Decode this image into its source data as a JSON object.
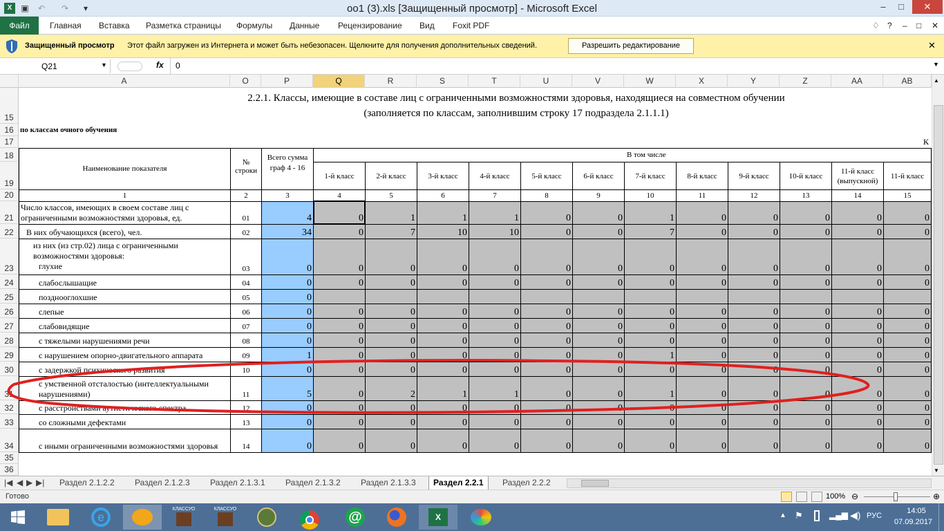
{
  "window": {
    "title": "oo1 (3).xls  [Защищенный просмотр]  -  Microsoft Excel",
    "controls": [
      "–",
      "□",
      "✕"
    ]
  },
  "ribbon_tabs": [
    "Файл",
    "Главная",
    "Вставка",
    "Разметка страницы",
    "Формулы",
    "Данные",
    "Рецензирование",
    "Вид",
    "Foxit PDF"
  ],
  "protected_view": {
    "label": "Защищенный просмотр",
    "message": "Этот файл загружен из Интернета и может быть небезопасен. Щелкните для получения дополнительных сведений.",
    "button": "Разрешить редактирование"
  },
  "formula_bar": {
    "name_box": "Q21",
    "fx": "fx",
    "value": "0"
  },
  "columns": [
    "A",
    "O",
    "P",
    "Q",
    "R",
    "S",
    "T",
    "U",
    "V",
    "W",
    "X",
    "Y",
    "Z",
    "AA",
    "AB"
  ],
  "rows": [
    "15",
    "16",
    "17",
    "18",
    "19",
    "20",
    "21",
    "22",
    "23",
    "24",
    "25",
    "26",
    "27",
    "28",
    "29",
    "30",
    "31",
    "32",
    "33",
    "34",
    "35",
    "36"
  ],
  "sheet": {
    "title_line1": "2.2.1. Классы, имеющие в составе лиц с ограниченными возможностями здоровья, находящиеся на совместном обучении",
    "title_line2": "(заполняется по классам, заполнившим строку 17 подраздела 2.1.1.1)",
    "subtitle": "по классам очного обучения",
    "corner_text": "К",
    "header_name": "Наименование показателя",
    "header_rownum": "№ строки",
    "header_total": "Всего сумма граф 4 - 16",
    "header_group": "В том числе",
    "class_headers": [
      "1-й класс",
      "2-й класс",
      "3-й класс",
      "4-й класс",
      "5-й класс",
      "6-й класс",
      "7-й класс",
      "8-й класс",
      "9-й класс",
      "10-й класс",
      "11-й класс (выпускной)",
      "11-й класс"
    ],
    "col_numbers": [
      "1",
      "2",
      "3",
      "4",
      "5",
      "6",
      "7",
      "8",
      "9",
      "10",
      "11",
      "12",
      "13",
      "14",
      "15"
    ],
    "data_rows": [
      {
        "label": "Число классов, имеющих в своем составе лиц с ограниченными возможностями здоровья, ед.",
        "code": "01",
        "total": "4",
        "vals": [
          "0",
          "1",
          "1",
          "1",
          "0",
          "0",
          "1",
          "0",
          "0",
          "0",
          "0",
          "0"
        ]
      },
      {
        "label": "В них обучающихся (всего), чел.",
        "code": "02",
        "total": "34",
        "vals": [
          "0",
          "7",
          "10",
          "10",
          "0",
          "0",
          "7",
          "0",
          "0",
          "0",
          "0",
          "0"
        ]
      },
      {
        "label": "из них (из стр.02) лица с ограниченными возможностями здоровья:",
        "sub": "глухие",
        "code": "03",
        "total": "0",
        "vals": [
          "0",
          "0",
          "0",
          "0",
          "0",
          "0",
          "0",
          "0",
          "0",
          "0",
          "0",
          "0"
        ]
      },
      {
        "label": "слабослышащие",
        "code": "04",
        "total": "0",
        "vals": [
          "0",
          "0",
          "0",
          "0",
          "0",
          "0",
          "0",
          "0",
          "0",
          "0",
          "0",
          "0"
        ]
      },
      {
        "label": "позднооглохшие",
        "code": "05",
        "total": "0",
        "vals": [
          "",
          "",
          "",
          "",
          "",
          "",
          "",
          "",
          "",
          "",
          "",
          ""
        ]
      },
      {
        "label": "слепые",
        "code": "06",
        "total": "0",
        "vals": [
          "0",
          "0",
          "0",
          "0",
          "0",
          "0",
          "0",
          "0",
          "0",
          "0",
          "0",
          "0"
        ]
      },
      {
        "label": "слабовидящие",
        "code": "07",
        "total": "0",
        "vals": [
          "0",
          "0",
          "0",
          "0",
          "0",
          "0",
          "0",
          "0",
          "0",
          "0",
          "0",
          "0"
        ]
      },
      {
        "label": "с тяжелыми нарушениями речи",
        "code": "08",
        "total": "0",
        "vals": [
          "0",
          "0",
          "0",
          "0",
          "0",
          "0",
          "0",
          "0",
          "0",
          "0",
          "0",
          "0"
        ]
      },
      {
        "label": "с нарушением опорно-двигательного аппарата",
        "code": "09",
        "total": "1",
        "vals": [
          "0",
          "0",
          "0",
          "0",
          "0",
          "0",
          "1",
          "0",
          "0",
          "0",
          "0",
          "0"
        ]
      },
      {
        "label": "с задержкой психического развития",
        "code": "10",
        "total": "0",
        "vals": [
          "0",
          "0",
          "0",
          "0",
          "0",
          "0",
          "0",
          "0",
          "0",
          "0",
          "0",
          "0"
        ]
      },
      {
        "label": "с умственной отсталостью (интеллектуальными нарушениями)",
        "code": "11",
        "total": "5",
        "vals": [
          "0",
          "2",
          "1",
          "1",
          "0",
          "0",
          "1",
          "0",
          "0",
          "0",
          "0",
          "0"
        ]
      },
      {
        "label": "с расстройствами аутистического спектра",
        "code": "12",
        "total": "0",
        "vals": [
          "0",
          "0",
          "0",
          "0",
          "0",
          "0",
          "0",
          "0",
          "0",
          "0",
          "0",
          "0"
        ]
      },
      {
        "label": "со сложными дефектами",
        "code": "13",
        "total": "0",
        "vals": [
          "0",
          "0",
          "0",
          "0",
          "0",
          "0",
          "0",
          "0",
          "0",
          "0",
          "0",
          "0"
        ]
      },
      {
        "label": "с иными ограниченными возможностями здоровья",
        "code": "14",
        "total": "0",
        "vals": [
          "0",
          "0",
          "0",
          "0",
          "0",
          "0",
          "0",
          "0",
          "0",
          "0",
          "0",
          "0"
        ]
      }
    ]
  },
  "sheet_tabs": [
    "Раздел 2.1.2.2",
    "Раздел 2.1.2.3",
    "Раздел 2.1.3.1",
    "Раздел 2.1.3.2",
    "Раздел 2.1.3.3",
    "Раздел 2.2.1",
    "Раздел 2.2.2"
  ],
  "active_sheet": "Раздел 2.2.1",
  "status": {
    "ready": "Готово",
    "zoom": "100%"
  },
  "taskbar": {
    "lang": "РУС",
    "time": "14:05",
    "date": "07.09.2017",
    "app_labels": [
      "КЛАССУО",
      "КЛАССУО"
    ]
  },
  "colors": {
    "accent": "#1f7244",
    "highlight_oval": "#e02020",
    "gray_cell": "#c0c0c0",
    "blue_cell": "#99ccff",
    "protected_bar": "#fff1a8"
  }
}
